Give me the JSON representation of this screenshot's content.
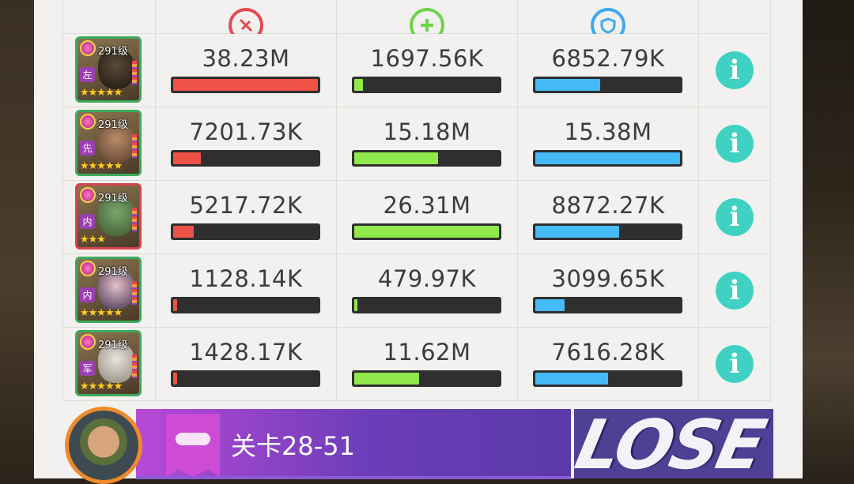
{
  "headers": {
    "damage_icon": "damage-icon",
    "heal_icon": "heal-icon",
    "defense_icon": "shield-icon"
  },
  "colors": {
    "damage": "#ee5146",
    "heal": "#8fe84c",
    "defense": "#44baf7",
    "info": "#3fd2c3",
    "lose_bg": "#4f3f95"
  },
  "heroes": [
    {
      "level": "291级",
      "position": "左",
      "stars": "★★★★★",
      "portrait": "black",
      "damage": "38.23M",
      "damage_pct": 1.0,
      "heal": "1697.56K",
      "heal_pct": 0.06,
      "defense": "6852.79K",
      "defense_pct": 0.45
    },
    {
      "level": "291级",
      "position": "先",
      "stars": "★★★★★",
      "portrait": "tan",
      "damage": "7201.73K",
      "damage_pct": 0.19,
      "heal": "15.18M",
      "heal_pct": 0.58,
      "defense": "15.38M",
      "defense_pct": 1.0
    },
    {
      "level": "291级",
      "position": "内",
      "stars": "★★★",
      "portrait": "green",
      "border": "red",
      "damage": "5217.72K",
      "damage_pct": 0.14,
      "heal": "26.31M",
      "heal_pct": 1.0,
      "defense": "8872.27K",
      "defense_pct": 0.58
    },
    {
      "level": "291级",
      "position": "内",
      "stars": "★★★★★",
      "portrait": "dark",
      "damage": "1128.14K",
      "damage_pct": 0.03,
      "heal": "479.97K",
      "heal_pct": 0.02,
      "defense": "3099.65K",
      "defense_pct": 0.2
    },
    {
      "level": "291级",
      "position": "军",
      "stars": "★★★★★",
      "portrait": "white",
      "damage": "1428.17K",
      "damage_pct": 0.03,
      "heal": "11.62M",
      "heal_pct": 0.45,
      "defense": "7616.28K",
      "defense_pct": 0.5
    }
  ],
  "footer": {
    "stage": "关卡28-51",
    "result": "LOSE"
  }
}
